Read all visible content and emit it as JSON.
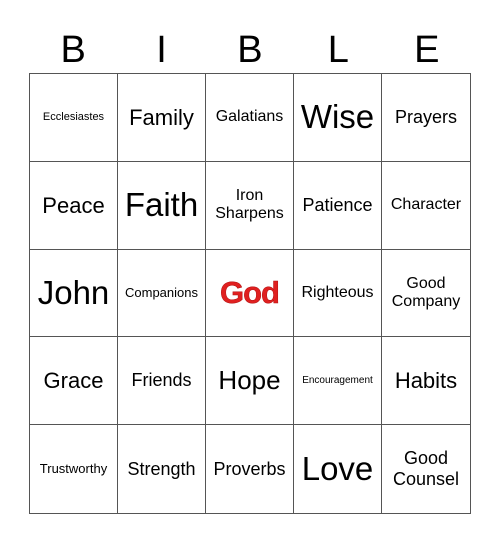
{
  "card": {
    "title_letters": [
      "B",
      "I",
      "B",
      "L",
      "E"
    ],
    "free_space_color": "#e02020",
    "cells": [
      {
        "text": "Ecclesiastes",
        "free": false
      },
      {
        "text": "Family",
        "free": false
      },
      {
        "text": "Galatians",
        "free": false
      },
      {
        "text": "Wise",
        "free": false
      },
      {
        "text": "Prayers",
        "free": false
      },
      {
        "text": "Peace",
        "free": false
      },
      {
        "text": "Faith",
        "free": false
      },
      {
        "text": "Iron Sharpens",
        "free": false
      },
      {
        "text": "Patience",
        "free": false
      },
      {
        "text": "Character",
        "free": false
      },
      {
        "text": "John",
        "free": false
      },
      {
        "text": "Companions",
        "free": false
      },
      {
        "text": "God",
        "free": true
      },
      {
        "text": "Righteous",
        "free": false
      },
      {
        "text": "Good Company",
        "free": false
      },
      {
        "text": "Grace",
        "free": false
      },
      {
        "text": "Friends",
        "free": false
      },
      {
        "text": "Hope",
        "free": false
      },
      {
        "text": "Encouragement",
        "free": false
      },
      {
        "text": "Habits",
        "free": false
      },
      {
        "text": "Trustworthy",
        "free": false
      },
      {
        "text": "Strength",
        "free": false
      },
      {
        "text": "Proverbs",
        "free": false
      },
      {
        "text": "Love",
        "free": false
      },
      {
        "text": "Good Counsel",
        "free": false
      }
    ]
  }
}
